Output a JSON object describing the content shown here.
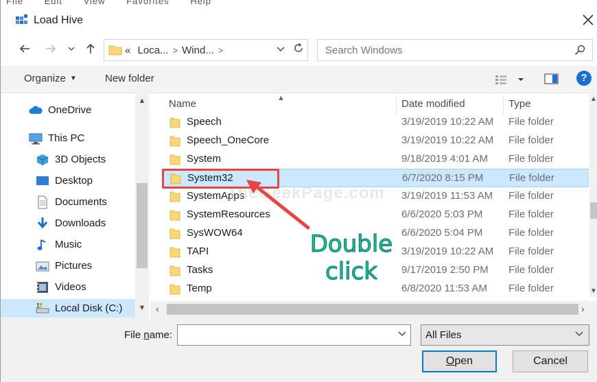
{
  "window": {
    "title": "Load Hive"
  },
  "menu_remnant": [
    "File",
    "Edit",
    "View",
    "Favorites",
    "Help"
  ],
  "address": {
    "crumbs": [
      "«",
      "Loca...",
      "Wind..."
    ],
    "separator": ">"
  },
  "search": {
    "placeholder": "Search Windows"
  },
  "toolbar": {
    "organize_label": "Organize",
    "new_folder_label": "New folder",
    "help_label": "?"
  },
  "nav_pane": {
    "items": [
      {
        "label": "OneDrive",
        "icon": "cloud-icon"
      },
      {
        "label": "This PC",
        "icon": "computer-icon"
      },
      {
        "label": "3D Objects",
        "icon": "cube-icon"
      },
      {
        "label": "Desktop",
        "icon": "desktop-icon"
      },
      {
        "label": "Documents",
        "icon": "document-icon"
      },
      {
        "label": "Downloads",
        "icon": "download-icon"
      },
      {
        "label": "Music",
        "icon": "music-icon"
      },
      {
        "label": "Pictures",
        "icon": "pictures-icon"
      },
      {
        "label": "Videos",
        "icon": "videos-icon"
      },
      {
        "label": "Local Disk (C:)",
        "icon": "drive-icon",
        "selected": true
      }
    ]
  },
  "file_list": {
    "columns": [
      "Name",
      "Date modified",
      "Type"
    ],
    "rows": [
      {
        "name": "Speech",
        "date": "3/19/2019 10:22 AM",
        "type": "File folder"
      },
      {
        "name": "Speech_OneCore",
        "date": "3/19/2019 10:22 AM",
        "type": "File folder"
      },
      {
        "name": "System",
        "date": "9/18/2019 4:01 AM",
        "type": "File folder"
      },
      {
        "name": "System32",
        "date": "6/7/2020 8:15 PM",
        "type": "File folder",
        "selected": true
      },
      {
        "name": "SystemApps",
        "date": "3/19/2019 11:53 AM",
        "type": "File folder"
      },
      {
        "name": "SystemResources",
        "date": "6/6/2020 5:03 PM",
        "type": "File folder"
      },
      {
        "name": "SysWOW64",
        "date": "6/6/2020 5:04 PM",
        "type": "File folder"
      },
      {
        "name": "TAPI",
        "date": "3/19/2019 10:22 AM",
        "type": "File folder"
      },
      {
        "name": "Tasks",
        "date": "9/17/2019 2:50 PM",
        "type": "File folder"
      },
      {
        "name": "Temp",
        "date": "6/8/2020 11:53 AM",
        "type": "File folder"
      }
    ]
  },
  "bottom": {
    "file_name_label_pre": "File ",
    "file_name_label_u": "n",
    "file_name_label_post": "ame:",
    "file_name_value": "",
    "filter_value": "All Files",
    "open_u": "O",
    "open_rest": "pen",
    "cancel_label": "Cancel"
  },
  "annotation": {
    "line1": "Double",
    "line2": "click",
    "watermark": "TheGeekPage.com"
  },
  "colors": {
    "accent": "#0078d7",
    "selection": "#cce8ff",
    "annotation_red": "#e74444",
    "annotation_text": "#16c4a0"
  }
}
